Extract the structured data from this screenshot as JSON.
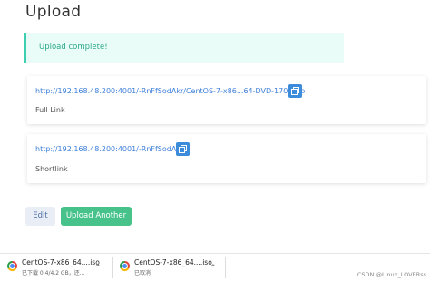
{
  "page": {
    "title": "Upload"
  },
  "alert": {
    "text": "Upload complete!"
  },
  "full_link": {
    "url": "http://192.168.48.200:4001/-RnFfSodAkr/CentOS-7-x86_64-DVD-1708.iso",
    "url_display": "http://192.168.48.200:4001/-RnFfSodAkr/CentOS-7-x86...64-DVD-1708.iso",
    "label": "Full Link",
    "copy_icon": "copy-icon"
  },
  "short_link": {
    "url": "http://192.168.48.200:4001/-RnFfSodAkr",
    "label": "Shortlink",
    "copy_icon": "copy-icon"
  },
  "buttons": {
    "edit": "Edit",
    "upload_another": "Upload Another"
  },
  "downloads": [
    {
      "name": "CentOS-7-x86_64....iso",
      "status": "已下载 0.4/4.2 GB，还…",
      "chevron": "^"
    },
    {
      "name": "CentOS-7-x86_64....iso",
      "status": "已取消",
      "chevron": "^"
    }
  ],
  "watermark": "CSDN @Linux_LOVERss",
  "colors": {
    "alert_bg": "#eafcf7",
    "alert_accent": "#3ccfb0",
    "link": "#3d7fd9",
    "primary": "#47c28b",
    "copy_button": "#3d8bdb"
  }
}
